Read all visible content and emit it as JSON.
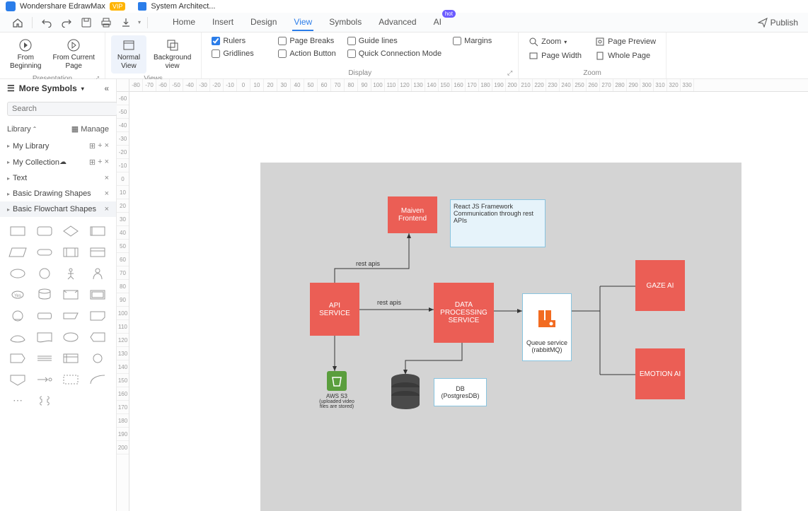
{
  "app": {
    "name": "Wondershare EdrawMax",
    "badge": "VIP",
    "docTitle": "System Architect..."
  },
  "menu": {
    "home": "Home",
    "insert": "Insert",
    "design": "Design",
    "view": "View",
    "symbols": "Symbols",
    "advanced": "Advanced",
    "ai": "AI",
    "hot": "hot",
    "publish": "Publish"
  },
  "ribbon": {
    "presentation": {
      "label": "Presentation",
      "fromBeginning": "From\nBeginning",
      "fromCurrent": "From Current\nPage"
    },
    "views": {
      "label": "Views",
      "normal": "Normal\nView",
      "background": "Background\nview"
    },
    "display": {
      "label": "Display",
      "rulers": "Rulers",
      "pageBreaks": "Page Breaks",
      "guideLines": "Guide lines",
      "margins": "Margins",
      "gridlines": "Gridlines",
      "actionButton": "Action Button",
      "quickConn": "Quick Connection Mode"
    },
    "zoom": {
      "label": "Zoom",
      "zoom": "Zoom",
      "pagePreview": "Page Preview",
      "pageWidth": "Page Width",
      "wholePage": "Whole Page"
    }
  },
  "sidebar": {
    "title": "More Symbols",
    "searchPlaceholder": "Search",
    "searchBtn": "Search",
    "library": "Library",
    "manage": "Manage",
    "items": [
      {
        "label": "My Library",
        "actions": true
      },
      {
        "label": "My Collection",
        "cloud": true,
        "actions": true
      },
      {
        "label": "Text"
      },
      {
        "label": "Basic Drawing Shapes"
      },
      {
        "label": "Basic Flowchart Shapes",
        "active": true
      }
    ]
  },
  "diagram": {
    "nodes": {
      "frontend": "Maiven\nFrontend",
      "react": "React JS Framework Communication through rest APIs",
      "api": "API\nSERVICE",
      "dataproc": "DATA\nPROCESSING\nSERVICE",
      "queue1": "Queue service",
      "queue2": "(rabbitMQ)",
      "gaze": "GAZE AI",
      "emotion": "EMOTION AI",
      "s3title": "AWS S3",
      "s3sub": "(uploaded video\nfiles are stored)",
      "db1": "DB",
      "db2": "(PostgresDB)"
    },
    "edges": {
      "restapis1": "rest apis",
      "restapis2": "rest apis"
    }
  },
  "rulerH": [
    "-80",
    "-70",
    "-60",
    "-50",
    "-40",
    "-30",
    "-20",
    "-10",
    "0",
    "10",
    "20",
    "30",
    "40",
    "50",
    "60",
    "70",
    "80",
    "90",
    "100",
    "110",
    "120",
    "130",
    "140",
    "150",
    "160",
    "170",
    "180",
    "190",
    "200",
    "210",
    "220",
    "230",
    "240",
    "250",
    "260",
    "270",
    "280",
    "290",
    "300",
    "310",
    "320",
    "330"
  ],
  "rulerV": [
    "-60",
    "-50",
    "-40",
    "-30",
    "-20",
    "-10",
    "0",
    "10",
    "20",
    "30",
    "40",
    "50",
    "60",
    "70",
    "80",
    "90",
    "100",
    "110",
    "120",
    "130",
    "140",
    "150",
    "160",
    "170",
    "180",
    "190",
    "200"
  ]
}
